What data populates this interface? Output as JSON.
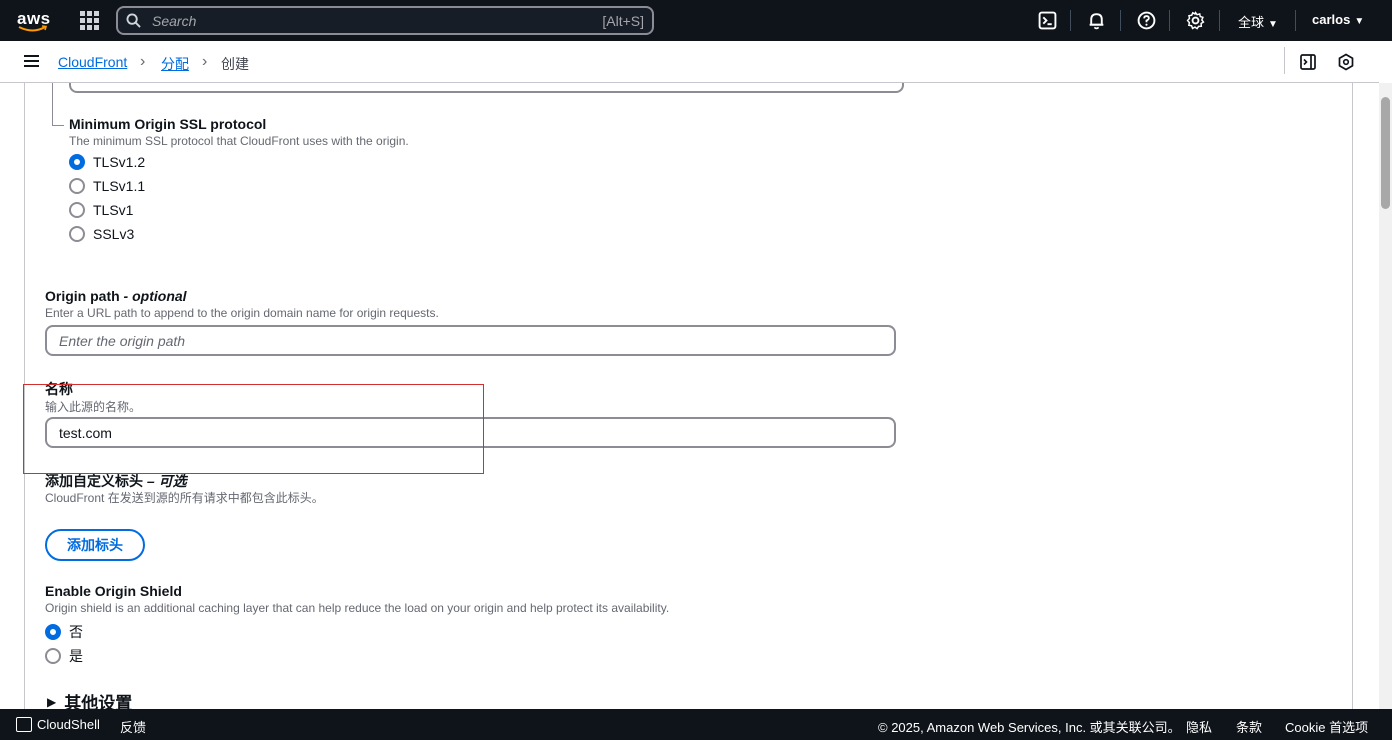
{
  "topnav": {
    "logo_text": "aws",
    "search_placeholder": "Search",
    "search_shortcut": "[Alt+S]",
    "region_label": "全球",
    "user_label": "carlos"
  },
  "breadcrumb": {
    "items": [
      "CloudFront",
      "分配",
      "创建"
    ]
  },
  "form": {
    "min_ssl": {
      "label": "Minimum Origin SSL protocol",
      "description": "The minimum SSL protocol that CloudFront uses with the origin.",
      "options": [
        "TLSv1.2",
        "TLSv1.1",
        "TLSv1",
        "SSLv3"
      ],
      "selected": "TLSv1.2"
    },
    "origin_path": {
      "label": "Origin path",
      "label_suffix": " - optional",
      "description": "Enter a URL path to append to the origin domain name for origin requests.",
      "placeholder": "Enter the origin path",
      "value": ""
    },
    "name": {
      "label": "名称",
      "description": "输入此源的名称。",
      "value": "test.com"
    },
    "custom_header": {
      "label": "添加自定义标头",
      "label_suffix": " – 可选",
      "description": "CloudFront 在发送到源的所有请求中都包含此标头。",
      "button": "添加标头"
    },
    "origin_shield": {
      "label": "Enable Origin Shield",
      "description": "Origin shield is an additional caching layer that can help reduce the load on your origin and help protect its availability.",
      "options": [
        "否",
        "是"
      ],
      "selected": "否"
    },
    "other_settings": {
      "label": "其他设置"
    }
  },
  "footer": {
    "cloudshell": "CloudShell",
    "feedback": "反馈",
    "copyright": "© 2025, Amazon Web Services, Inc. 或其关联公司。",
    "privacy": "隐私",
    "terms": "条款",
    "cookie": "Cookie 首选项"
  },
  "colors": {
    "nav_bg": "#0f141a",
    "link": "#006ce0",
    "highlight_box": "#d32f2f"
  }
}
